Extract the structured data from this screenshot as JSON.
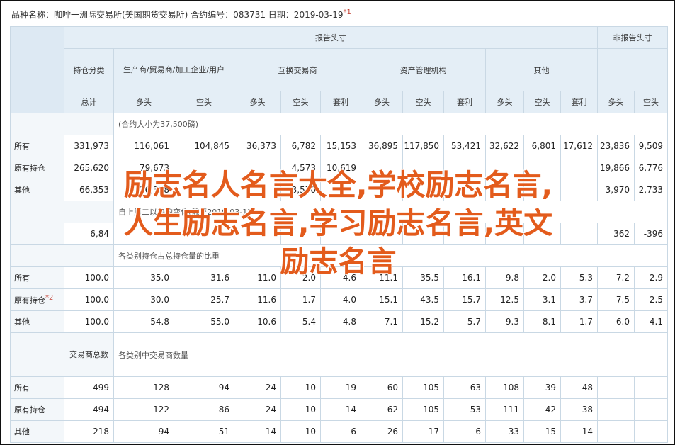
{
  "header": {
    "text": "品种名称：咖啡一洲际交易所(美国期货交易所)    合约编号：083731    日期：2019-03-19",
    "mark": "*1"
  },
  "table": {
    "h1": {
      "report": "报告头寸",
      "nonreport": "非报告头寸"
    },
    "h2": {
      "holding": "持仓分类",
      "producer": "生产商/贸易商/加工企业/用户",
      "swap": "互换交易商",
      "money": "资产管理机构",
      "other": "其他"
    },
    "h3": {
      "total": "总计",
      "long": "多头",
      "short": "空头",
      "spread": "套利"
    },
    "sec1_note": "(合约大小为37,500磅)",
    "sec1_rows": [
      {
        "label": "所有",
        "vals": [
          "331,973",
          "116,061",
          "104,845",
          "36,373",
          "6,782",
          "15,153",
          "36,895",
          "117,850",
          "53,421",
          "32,622",
          "6,801",
          "17,612",
          "23,836",
          "9,509"
        ]
      },
      {
        "label": "原有持仓",
        "vals": [
          "265,620",
          "79,673",
          "",
          "",
          "4,573",
          "10,619",
          "",
          "",
          "",
          "",
          "",
          "",
          "19,866",
          "6,776"
        ]
      },
      {
        "label": "其他",
        "vals": [
          "66,353",
          "36,388",
          "",
          "",
          "3,570",
          "",
          "",
          "",
          "",
          "",
          "",
          "",
          "3,970",
          "2,733"
        ]
      }
    ],
    "sec2_note": "自上周二以来的变化(截至2019-03-12",
    "sec2_row": {
      "vals": [
        "6,84",
        "",
        "",
        "",
        "",
        "",
        "",
        "",
        "",
        "",
        "",
        "",
        "362",
        "-396"
      ]
    },
    "sec3_note": "各类别持仓占总持仓量的比重",
    "sec3_rows": [
      {
        "label": "所有",
        "vals": [
          "100.0",
          "35.0",
          "31.6",
          "11.0",
          "2.0",
          "4.6",
          "11.1",
          "35.5",
          "16.1",
          "9.8",
          "2.0",
          "5.3",
          "7.2",
          "2.9"
        ]
      },
      {
        "label": "原有持仓",
        "mark": "*2",
        "vals": [
          "100.0",
          "30.0",
          "25.7",
          "11.6",
          "1.7",
          "4.0",
          "15.1",
          "43.5",
          "15.7",
          "12.5",
          "3.1",
          "3.7",
          "7.5",
          "2.5"
        ]
      },
      {
        "label": "其他",
        "vals": [
          "100.0",
          "54.8",
          "55.0",
          "10.6",
          "5.4",
          "4.8",
          "7.1",
          "15.2",
          "5.7",
          "9.3",
          "8.1",
          "1.7",
          "6.0",
          "4.1"
        ]
      }
    ],
    "sec4_head": "交易商总数",
    "sec4_note": "各类别中交易商数量",
    "sec4_rows": [
      {
        "label": "所有",
        "vals": [
          "499",
          "128",
          "94",
          "24",
          "10",
          "19",
          "60",
          "105",
          "63",
          "108",
          "39",
          "48",
          "",
          ""
        ]
      },
      {
        "label": "原有持仓",
        "vals": [
          "494",
          "122",
          "86",
          "24",
          "10",
          "14",
          "62",
          "105",
          "53",
          "111",
          "42",
          "38",
          "",
          ""
        ]
      },
      {
        "label": "其他",
        "vals": [
          "218",
          "94",
          "51",
          "14",
          "10",
          "6",
          "26",
          "17",
          "6",
          "33",
          "15",
          "14",
          "",
          ""
        ]
      }
    ]
  },
  "overlay": {
    "line1": "励志名人名言大全,学校励志名言,",
    "line2": "人生励志名言,学习励志名言,英文",
    "line3": "励志名言"
  }
}
